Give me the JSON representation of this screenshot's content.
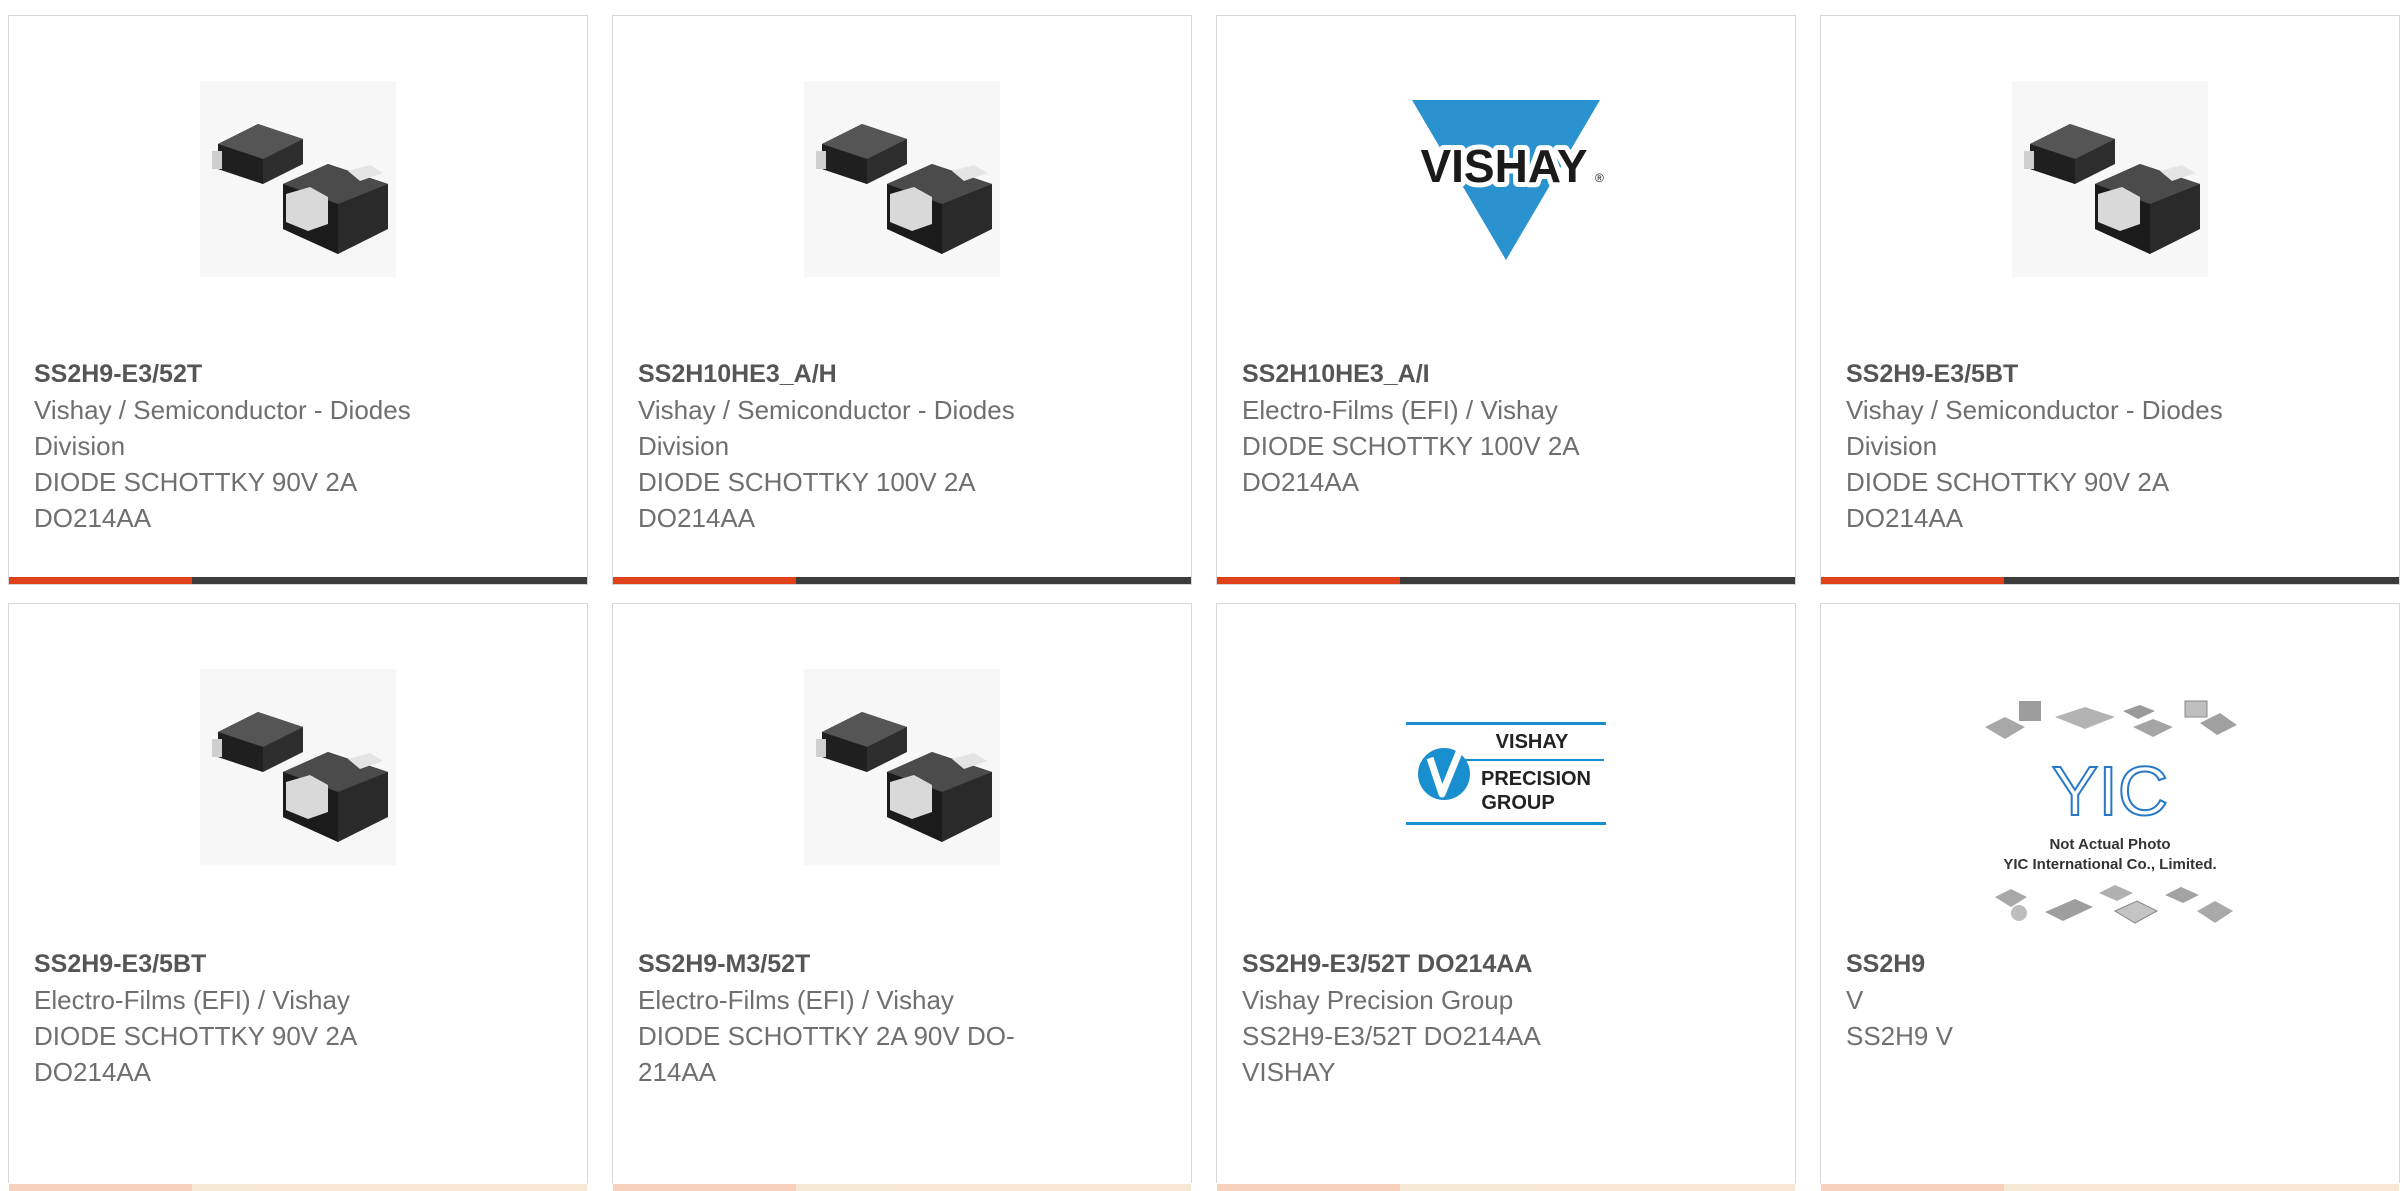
{
  "products": [
    {
      "part_number": "SS2H9-E3/52T",
      "lines": [
        "Vishay / Semiconductor - Diodes",
        "Division",
        "DIODE SCHOTTKY 90V 2A",
        "DO214AA"
      ],
      "image": "diode-package-icon"
    },
    {
      "part_number": "SS2H10HE3_A/H",
      "lines": [
        "Vishay / Semiconductor - Diodes",
        "Division",
        "DIODE SCHOTTKY 100V 2A",
        "DO214AA"
      ],
      "image": "diode-package-icon"
    },
    {
      "part_number": "SS2H10HE3_A/I",
      "lines": [
        "Electro-Films (EFI) / Vishay",
        "DIODE SCHOTTKY 100V 2A",
        "DO214AA"
      ],
      "image": "vishay-logo",
      "logo_text": "VISHAY",
      "logo_mark": "®",
      "logo_color": "#2a93cf"
    },
    {
      "part_number": "SS2H9-E3/5BT",
      "lines": [
        "Vishay / Semiconductor - Diodes",
        "Division",
        "DIODE SCHOTTKY 90V 2A",
        "DO214AA"
      ],
      "image": "diode-package-icon"
    },
    {
      "part_number": "SS2H9-E3/5BT",
      "lines": [
        "Electro-Films (EFI) / Vishay",
        "DIODE SCHOTTKY 90V 2A",
        "DO214AA"
      ],
      "image": "diode-package-icon"
    },
    {
      "part_number": "SS2H9-M3/52T",
      "lines": [
        "Electro-Films (EFI) / Vishay",
        "DIODE SCHOTTKY 2A 90V DO-",
        "214AA"
      ],
      "image": "diode-package-icon"
    },
    {
      "part_number": "SS2H9-E3/52T DO214AA",
      "lines": [
        "Vishay Precision Group",
        "SS2H9-E3/52T DO214AA",
        "VISHAY"
      ],
      "image": "vishay-precision-group-logo",
      "logo_lines": [
        "VISHAY",
        "PRECISION",
        "GROUP"
      ],
      "logo_color": "#1a8fcf"
    },
    {
      "part_number": "SS2H9",
      "lines": [
        "V",
        "SS2H9 V"
      ],
      "image": "yic-placeholder-logo",
      "logo_text": "YIC",
      "logo_caption": [
        "Not Actual Photo",
        "YIC International Co., Limited."
      ]
    }
  ],
  "colors": {
    "accent": "#e0401a",
    "bar": "#3c3c3c",
    "border": "#d6d6d6",
    "title": "#555555",
    "text": "#6f6f6f"
  }
}
